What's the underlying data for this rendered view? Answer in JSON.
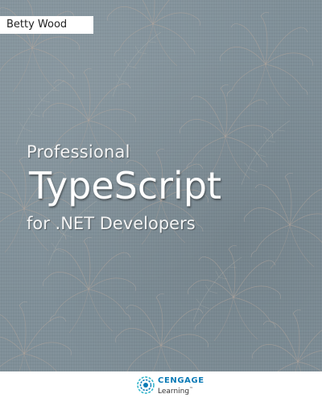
{
  "cover": {
    "author": "Betty Wood",
    "title_line1": "Professional",
    "title_main": "TypeScript",
    "title_line3": "for .NET Developers",
    "colors": {
      "background": "#7f8f98",
      "title_text": "#ffffff",
      "author_tab": "#ffffff"
    }
  },
  "publisher": {
    "name": "CENGAGE",
    "sub": "Learning",
    "trademark": "™",
    "logo_icon": "cengage-swirl-icon",
    "colors": {
      "brand_blue": "#0a7ab6",
      "brand_teal": "#29b3c9"
    }
  }
}
